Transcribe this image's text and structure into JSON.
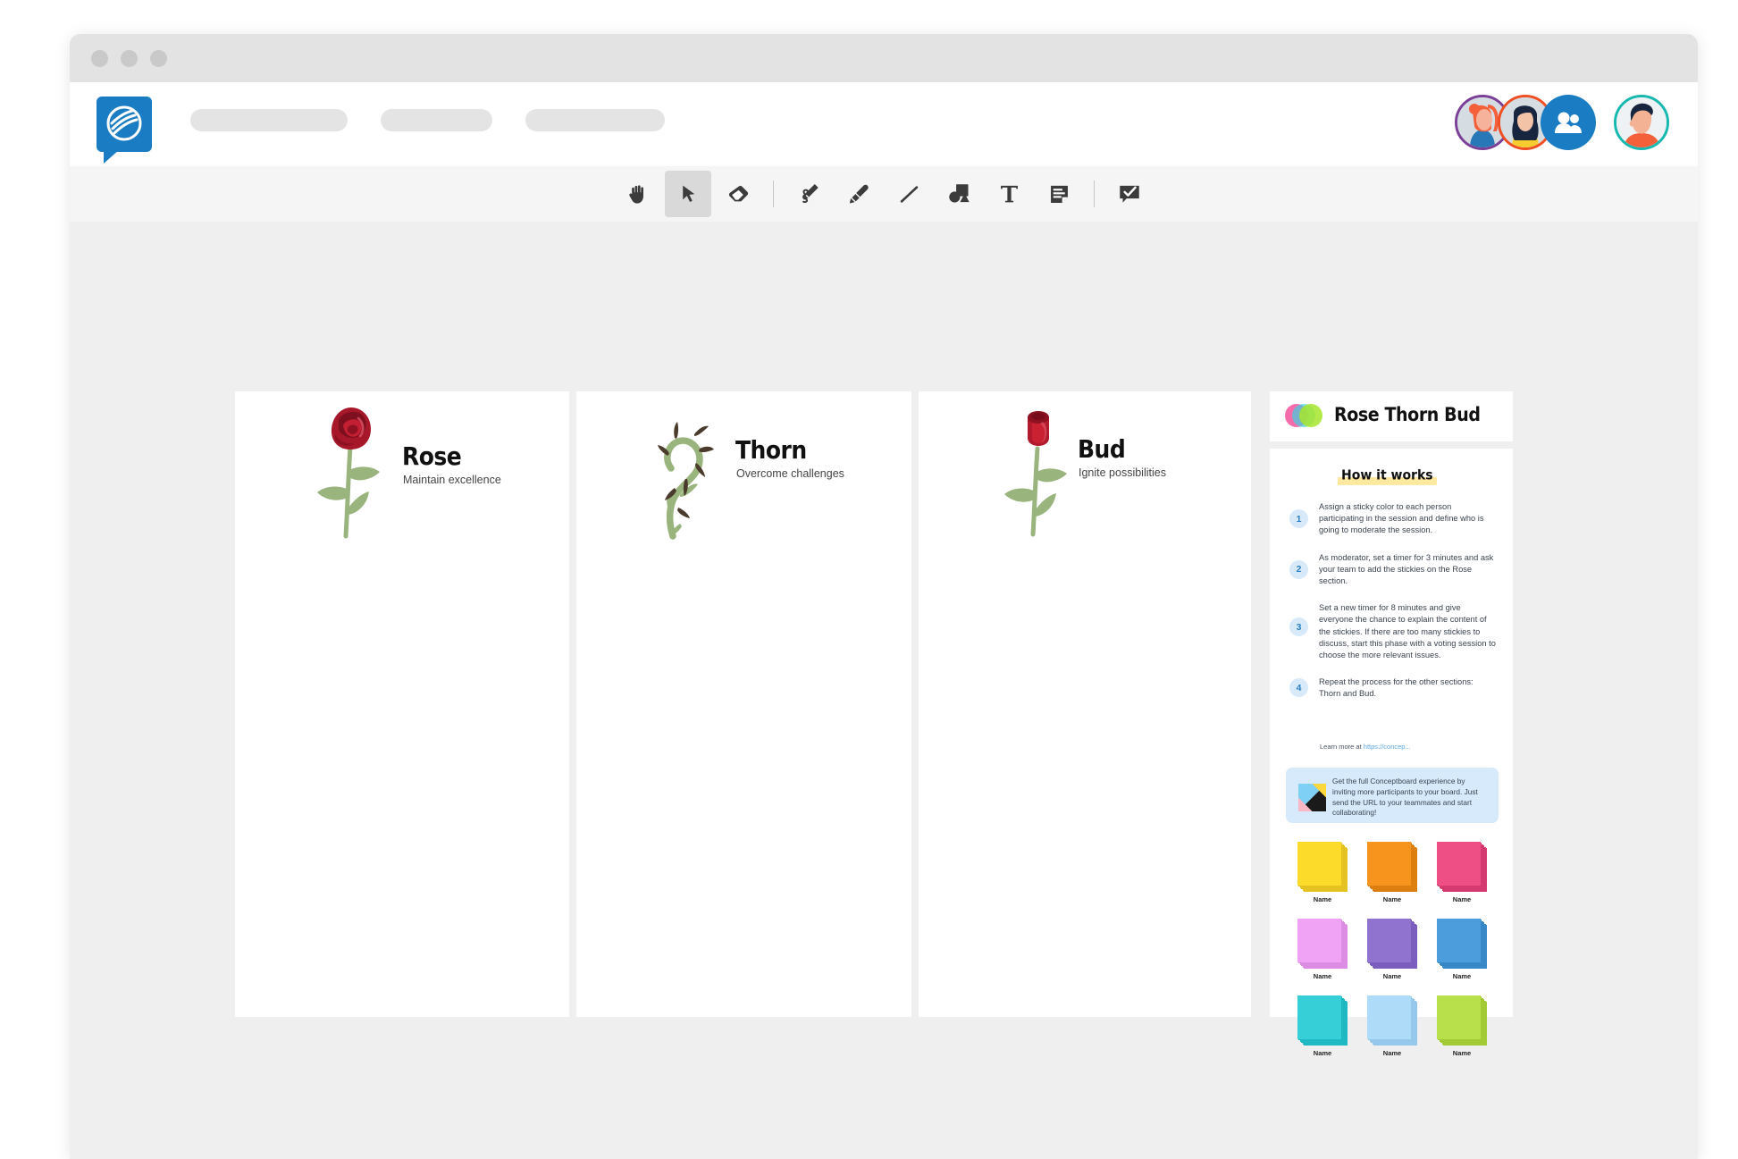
{
  "window": {
    "traffic_lights": [
      "close",
      "minimize",
      "maximize"
    ]
  },
  "header": {
    "logo_name": "conceptboard-logo",
    "nav_placeholders": [
      "",
      "",
      ""
    ],
    "avatars": [
      {
        "name": "avatar-user-1",
        "ring": "#7c3f98"
      },
      {
        "name": "avatar-user-2",
        "ring": "#f04e23"
      },
      {
        "name": "avatar-more-participants",
        "ring": "#1a7cc2"
      },
      {
        "name": "avatar-current-user",
        "ring": "#17b8b0"
      }
    ]
  },
  "toolbar": {
    "tools": [
      {
        "id": "hand",
        "label": "Hand / Pan",
        "icon": "hand-icon",
        "active": false
      },
      {
        "id": "select",
        "label": "Select",
        "icon": "cursor-icon",
        "active": true
      },
      {
        "id": "eraser",
        "label": "Eraser",
        "icon": "eraser-icon",
        "active": false
      },
      {
        "id": "pen",
        "label": "Pen",
        "icon": "pen-icon",
        "active": false
      },
      {
        "id": "highlighter",
        "label": "Highlighter",
        "icon": "highlighter-icon",
        "active": false
      },
      {
        "id": "line",
        "label": "Line",
        "icon": "line-icon",
        "active": false
      },
      {
        "id": "shapes",
        "label": "Shapes",
        "icon": "shapes-icon",
        "active": false
      },
      {
        "id": "text",
        "label": "Text",
        "icon": "text-icon",
        "active": false
      },
      {
        "id": "note",
        "label": "Sticky Note",
        "icon": "note-icon",
        "active": false
      },
      {
        "id": "comment",
        "label": "Comment",
        "icon": "comment-check-icon",
        "active": false
      }
    ]
  },
  "board": {
    "columns": [
      {
        "id": "rose",
        "title": "Rose",
        "subtitle": "Maintain excellence",
        "icon": "rose-flower-icon"
      },
      {
        "id": "thorn",
        "title": "Thorn",
        "subtitle": "Overcome challenges",
        "icon": "thorn-stem-icon"
      },
      {
        "id": "bud",
        "title": "Bud",
        "subtitle": "Ignite possibilities",
        "icon": "rose-bud-icon"
      }
    ]
  },
  "panel": {
    "title": "Rose Thorn Bud",
    "logo_name": "venn-circles-icon",
    "section_heading": "How it works",
    "steps": [
      {
        "num": "1",
        "text": "Assign a sticky color to each person participating in the session and define who is going to moderate the session."
      },
      {
        "num": "2",
        "text": "As moderator, set a timer for 3 minutes and ask your team to add the stickies on the Rose section."
      },
      {
        "num": "3",
        "text": "Set a new timer for 8 minutes and give everyone the chance to explain the content of the stickies. If there are too many stickies to discuss, start this phase with a voting session to choose the more relevant issues."
      },
      {
        "num": "4",
        "text": "Repeat the process for the other sections: Thorn and Bud."
      }
    ],
    "learn_more_prefix": "Learn more at ",
    "learn_more_link": "https://concep...",
    "promo": {
      "icon_name": "conceptboard-mark-icon",
      "text": "Get the full Conceptboard experience by inviting more participants to your board. Just send the URL to your teammates and start collaborating!"
    },
    "swatches": [
      {
        "name": "sticky-yellow",
        "label": "Name",
        "color": "#fcdb2b",
        "shade": "#e3c222"
      },
      {
        "name": "sticky-orange",
        "label": "Name",
        "color": "#f7941e",
        "shade": "#dd7f10"
      },
      {
        "name": "sticky-pink",
        "label": "Name",
        "color": "#ee4f85",
        "shade": "#d43a70"
      },
      {
        "name": "sticky-magenta",
        "label": "Name",
        "color": "#f0a3f5",
        "shade": "#dd8ce3"
      },
      {
        "name": "sticky-purple",
        "label": "Name",
        "color": "#9073cf",
        "shade": "#7a5dbc"
      },
      {
        "name": "sticky-blue",
        "label": "Name",
        "color": "#4c9ddb",
        "shade": "#3887c6"
      },
      {
        "name": "sticky-cyan",
        "label": "Name",
        "color": "#36cfd8",
        "shade": "#1fb9c3"
      },
      {
        "name": "sticky-lightblue",
        "label": "Name",
        "color": "#aedbf7",
        "shade": "#95c8ea"
      },
      {
        "name": "sticky-green",
        "label": "Name",
        "color": "#b8e04a",
        "shade": "#a2ca34"
      }
    ]
  },
  "colors": {
    "brand_blue": "#1a7cc2",
    "canvas_bg": "#efefef",
    "toolbar_bg": "#f5f5f5",
    "highlight_yellow": "#ffe9a0",
    "promo_bg": "#d6eafb"
  }
}
